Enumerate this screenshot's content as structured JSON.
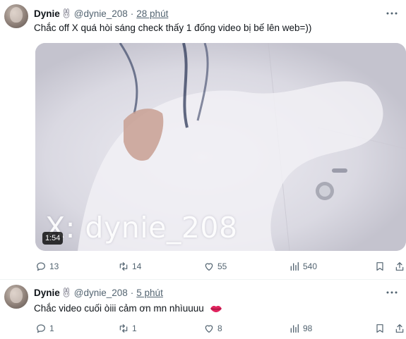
{
  "tweets": [
    {
      "display_name": "Dynie",
      "handle": "@dynie_208",
      "separator": "·",
      "time": "28 phút",
      "text": "Chắc off X quá hòi sáng check thấy 1 đống video bị bế lên web=))",
      "media": {
        "watermark": "X: dynie_208",
        "duration": "1:54"
      },
      "stats": {
        "replies": "13",
        "reposts": "14",
        "likes": "55",
        "views": "540"
      }
    },
    {
      "display_name": "Dynie",
      "handle": "@dynie_208",
      "separator": "·",
      "time": "5 phút",
      "text": "Chắc video cuối òiii cảm ơn mn nhìuuuu",
      "stats": {
        "replies": "1",
        "reposts": "1",
        "likes": "8",
        "views": "98"
      }
    }
  ],
  "icons": {
    "name_emoji": "rabbit-emoji",
    "text_emoji": "lips-emoji"
  },
  "colors": {
    "text_primary": "#0f1419",
    "text_secondary": "#536471",
    "divider": "#eff3f4"
  }
}
